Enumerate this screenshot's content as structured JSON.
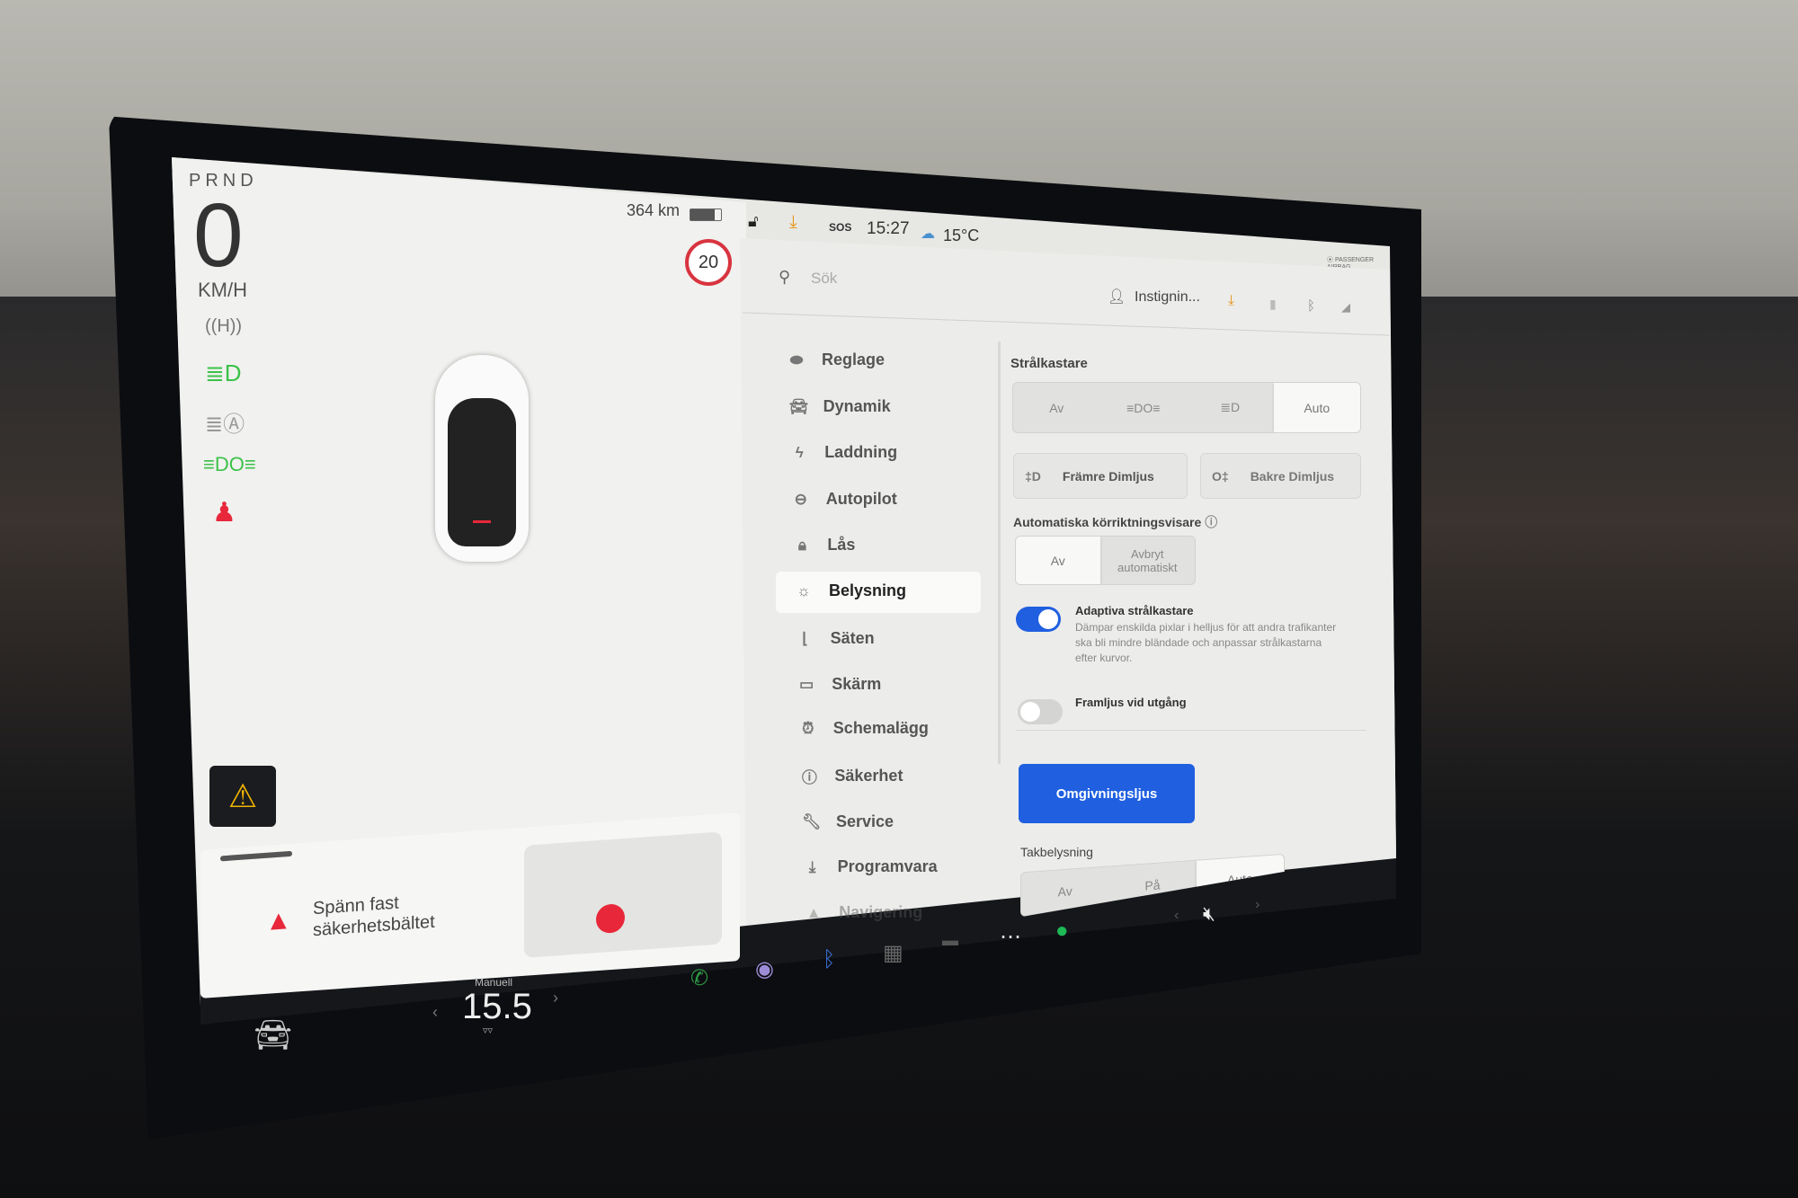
{
  "cluster": {
    "gears": "PRND",
    "speed": "0",
    "speed_unit": "KM/H",
    "range": "364 km",
    "battery_level_percent": 80,
    "speed_limit": "20",
    "indicators": [
      "auto-hold-icon",
      "low-beam-icon",
      "auto-high-beam-icon",
      "parking-lights-icon",
      "seatbelt-warning-icon"
    ],
    "indicator_colors": {
      "green": "#3cc24a",
      "red": "#e8283a",
      "gray": "#888888"
    }
  },
  "alert": {
    "message_line1": "Spänn fast",
    "message_line2": "säkerhetsbältet"
  },
  "status_bar": {
    "time": "15:27",
    "sos": "SOS",
    "temperature": "15°C",
    "airbag_label": "PASSENGER AIRBAG"
  },
  "settings": {
    "search_placeholder": "Sök",
    "profile_name": "Instignin...",
    "menu": [
      {
        "label": "Reglage",
        "icon": "toggle-icon"
      },
      {
        "label": "Dynamik",
        "icon": "car-icon"
      },
      {
        "label": "Laddning",
        "icon": "bolt-icon"
      },
      {
        "label": "Autopilot",
        "icon": "steering-wheel-icon"
      },
      {
        "label": "Lås",
        "icon": "lock-icon"
      },
      {
        "label": "Belysning",
        "icon": "light-icon",
        "active": true
      },
      {
        "label": "Säten",
        "icon": "seat-icon"
      },
      {
        "label": "Skärm",
        "icon": "display-icon"
      },
      {
        "label": "Schemalägg",
        "icon": "alarm-icon"
      },
      {
        "label": "Säkerhet",
        "icon": "info-icon"
      },
      {
        "label": "Service",
        "icon": "wrench-icon"
      },
      {
        "label": "Programvara",
        "icon": "download-icon"
      },
      {
        "label": "Navigering",
        "icon": "navigation-icon"
      }
    ],
    "headlights": {
      "label": "Strålkastare",
      "options": [
        "Av",
        "parking-lights-icon",
        "low-beam-icon",
        "Auto"
      ],
      "selected": "Auto"
    },
    "front_fog": "Främre Dimljus",
    "rear_fog": "Bakre Dimljus",
    "auto_turn": {
      "label": "Automatiska körriktningsvisare",
      "options": [
        "Av",
        "Avbryt automatiskt"
      ],
      "selected": "Av"
    },
    "adaptive": {
      "label": "Adaptiva strålkastare",
      "description": "Dämpar enskilda pixlar i helljus för att andra trafikanter ska bli mindre bländade och anpassar strålkastarna efter kurvor.",
      "enabled": true
    },
    "exit_lights": {
      "label": "Framljus vid utgång",
      "enabled": false
    },
    "ambient_button": "Omgivningsljus",
    "dome": {
      "label": "Takbelysning",
      "options": [
        "Av",
        "På",
        "Auto"
      ],
      "selected": "Auto"
    },
    "accent_color": "#1f5fe0"
  },
  "dock": {
    "climate_mode": "Manuell",
    "temperature": "15.5"
  }
}
